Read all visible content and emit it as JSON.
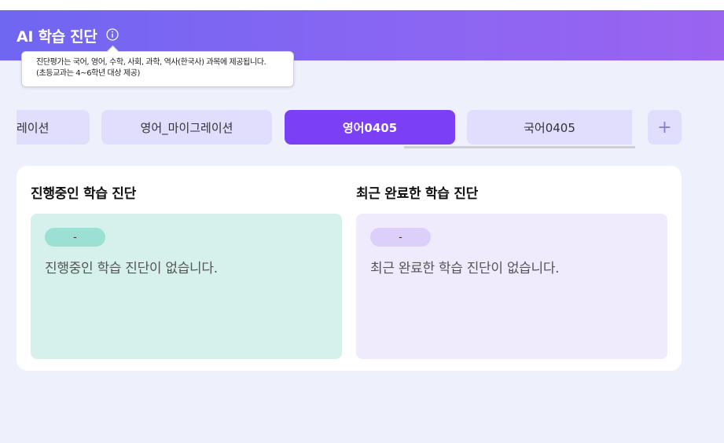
{
  "header": {
    "title": "AI 학습 진단",
    "info_icon": "info-circle-icon",
    "gradient": [
      "#6f66f2",
      "#9a63f0"
    ]
  },
  "tooltip": {
    "line1": "진단평가는 국어, 영어, 수학, 사회, 과학, 역사(한국사) 과목에 제공됩니다.",
    "line2": "(초등교과는 4~6학년 대상 제공)"
  },
  "tabs": [
    {
      "label": "영어_마이그레이션",
      "visible_label": "레이션",
      "active": false
    },
    {
      "label": "영어_마이그레이션",
      "active": false
    },
    {
      "label": "영어0405",
      "active": true
    },
    {
      "label": "국어0405",
      "active": false
    }
  ],
  "add_tab": {
    "label": "+",
    "icon": "plus-icon"
  },
  "ongoing": {
    "title": "진행중인 학습 진단",
    "badge": "-",
    "empty_message": "진행중인 학습 진단이 없습니다."
  },
  "completed": {
    "title": "최근 완료한 학습 진단",
    "badge": "-",
    "empty_message": "최근 완료한 학습 진단이 없습니다."
  },
  "colors": {
    "accent": "#7b3ff6",
    "tab_bg": "#e0defc",
    "ongoing_card": "#d6f1eb",
    "completed_card": "#efeafc"
  }
}
